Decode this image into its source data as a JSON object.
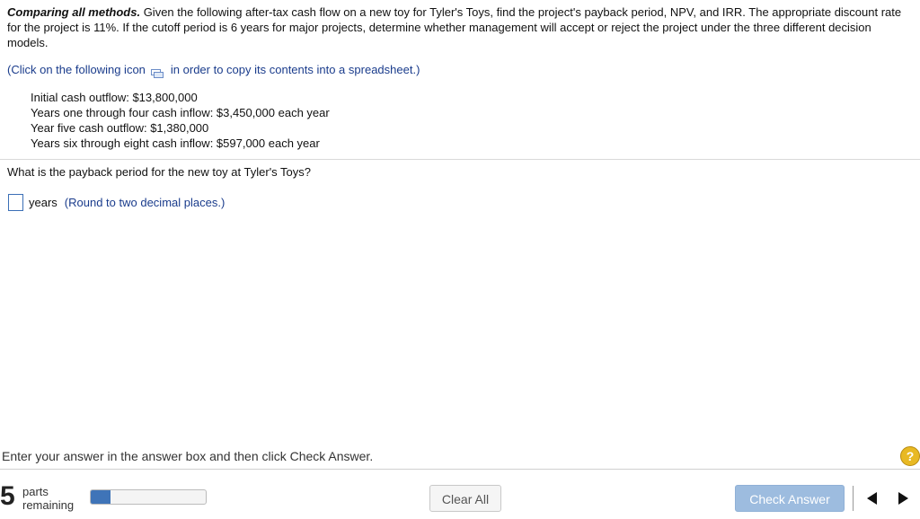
{
  "problem": {
    "title": "Comparing all methods.",
    "text": " Given the following after-tax cash flow on a new toy for Tyler's Toys, find the project's payback period, NPV, and IRR. The appropriate discount rate for the project is 11%. If the cutoff period is 6 years for major projects, determine whether management will accept or reject the project under the three different decision models."
  },
  "copy_note": {
    "before": "(Click on the following icon",
    "after": "in order to copy its contents into a spreadsheet.)",
    "icon": "copy-spreadsheet-icon"
  },
  "givens": [
    "Initial cash outflow: $13,800,000",
    "Years one through four cash inflow: $3,450,000 each year",
    "Year five cash outflow: $1,380,000",
    "Years six through eight cash inflow: $597,000 each year"
  ],
  "question": "What is the payback period for the new toy at Tyler's Toys?",
  "answer": {
    "value": "",
    "units": "years",
    "hint": "(Round to two decimal places.)"
  },
  "instructions": "Enter your answer in the answer box and then click Check Answer.",
  "help_label": "?",
  "footer": {
    "parts_count": "5",
    "parts_word": "parts",
    "remaining_word": "remaining",
    "progress_fraction": 0.17,
    "clear_label": "Clear All",
    "check_label": "Check Answer"
  },
  "colors": {
    "link_blue": "#1a3c8c",
    "progress_blue": "#3f74b8",
    "check_button": "#9dbcdf",
    "help_yellow": "#e8b923"
  }
}
